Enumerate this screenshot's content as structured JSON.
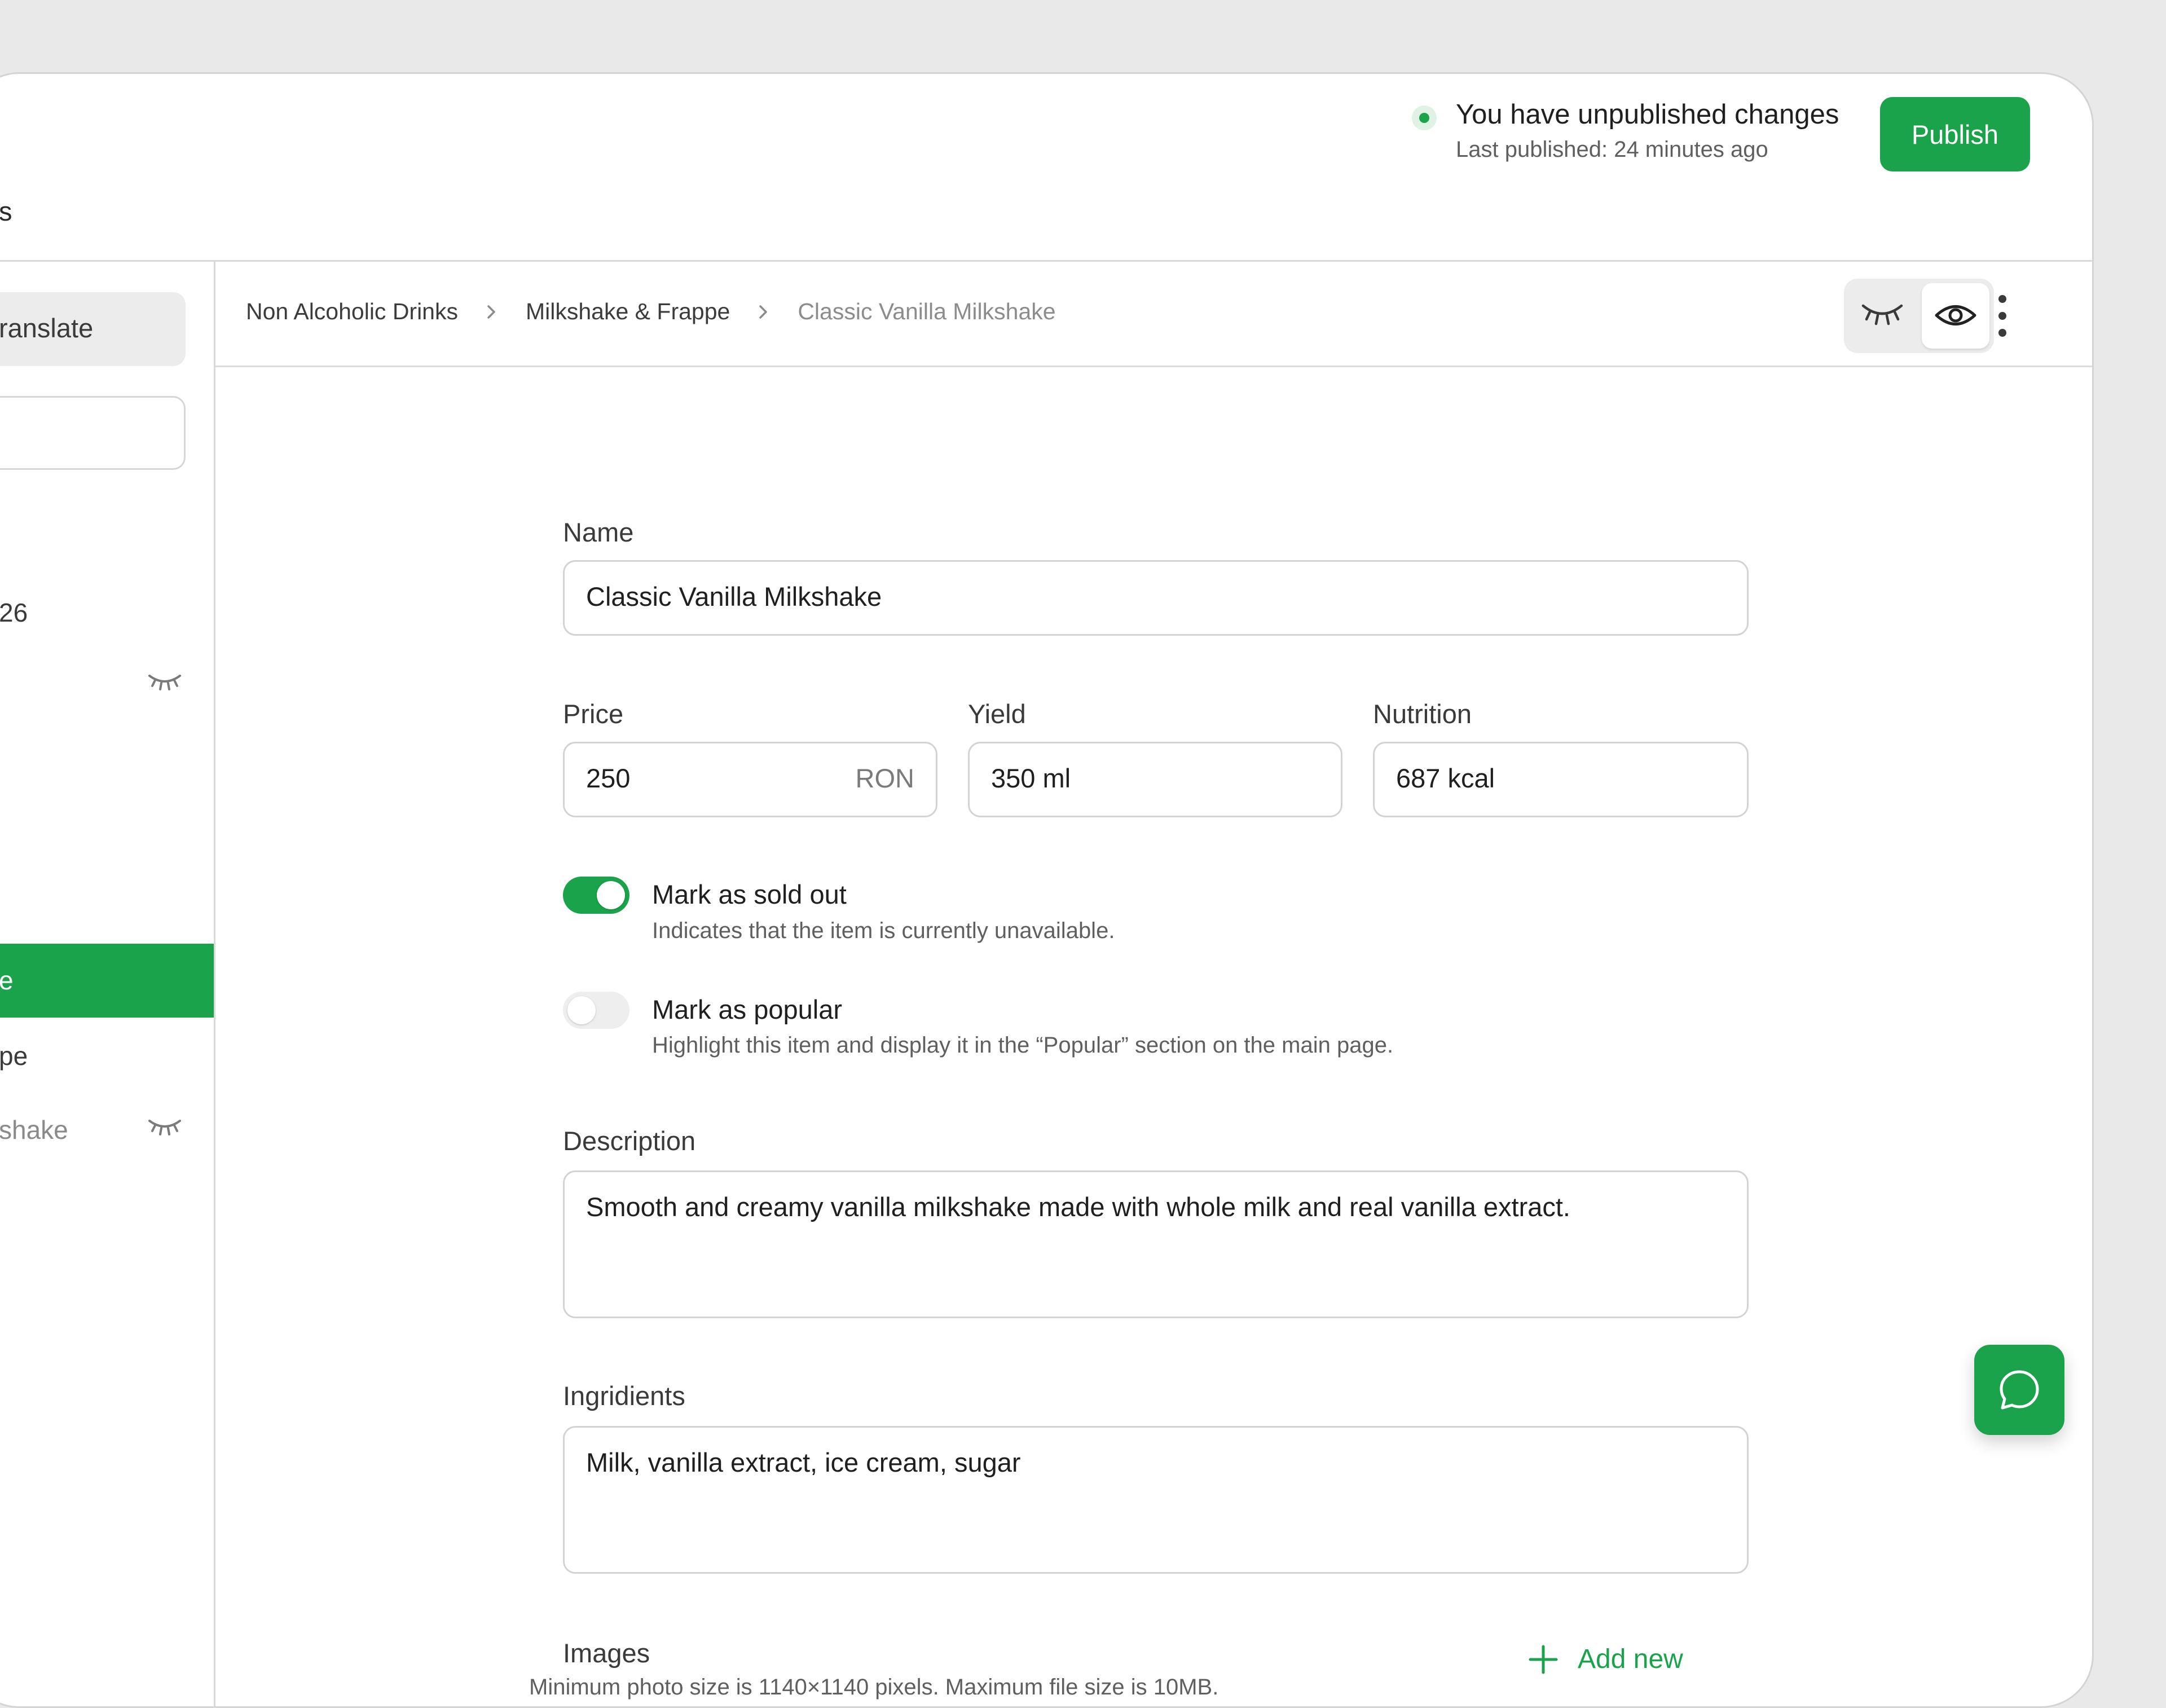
{
  "header": {
    "status_title": "You have unpublished changes",
    "status_subtitle": "Last published: 24 minutes ago",
    "publish_label": "Publish"
  },
  "sidebar": {
    "heading_partial": "s",
    "translate_label": "ranslate",
    "item_count_partial": "26",
    "active_item_partial": "e",
    "item_2_partial": "pe",
    "item_3_partial": "shake"
  },
  "breadcrumb": [
    "Non Alcoholic Drinks",
    "Milkshake & Frappe",
    "Classic Vanilla Milkshake"
  ],
  "form": {
    "name": {
      "label": "Name",
      "value": "Classic Vanilla Milkshake"
    },
    "price": {
      "label": "Price",
      "value": "250",
      "suffix": "RON"
    },
    "yield": {
      "label": "Yield",
      "value": "350 ml"
    },
    "nutrition": {
      "label": "Nutrition",
      "value": "687 kcal"
    },
    "sold_out": {
      "title": "Mark as sold out",
      "description": "Indicates that the item is currently unavailable.",
      "on": true
    },
    "popular": {
      "title": "Mark as popular",
      "description": "Highlight this item and display it in the “Popular” section on the main page.",
      "on": false
    },
    "description": {
      "label": "Description",
      "value": "Smooth and creamy vanilla milkshake made with whole milk and real vanilla extract."
    },
    "ingredients": {
      "label": "Ingridients",
      "value": "Milk, vanilla extract, ice cream, sugar"
    },
    "images": {
      "label": "Images",
      "subtitle": "Minimum photo size is 1140×1140 pixels. Maximum file size is 10MB.",
      "add_label": "Add new"
    }
  },
  "icons": {
    "status": "status-dot-icon",
    "hidden": "eye-closed-icon",
    "visible": "eye-icon",
    "more": "more-vertical-icon",
    "add": "plus-icon",
    "chat": "chat-bubble-icon",
    "breadcrumb_sep": "chevron-right-icon"
  },
  "colors": {
    "accent": "#1aa34a",
    "border": "#d3d3d3",
    "muted": "#5f5f5f"
  }
}
